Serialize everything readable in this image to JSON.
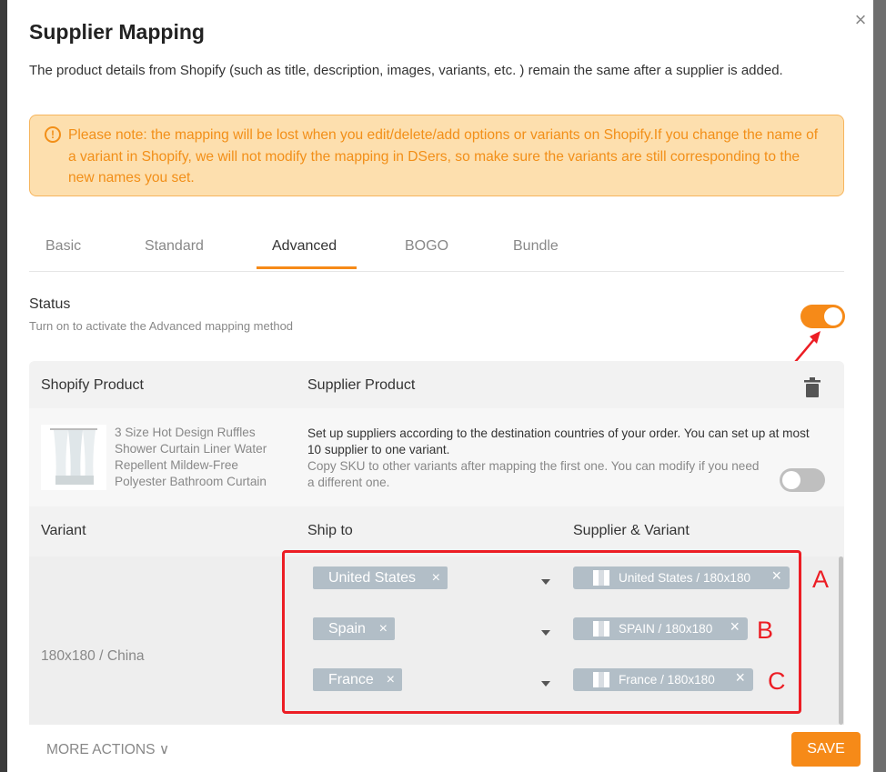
{
  "modal": {
    "title": "Supplier Mapping",
    "description": "The product details from Shopify (such as title, description, images, variants, etc. ) remain the same after a supplier is added.",
    "notice": "Please note: the mapping will be lost when you edit/delete/add options or variants on Shopify.If you change the name of a variant in Shopify, we will not modify the mapping in DSers, so make sure the variants are still corresponding to the new names you set.",
    "close_icon": "close-icon"
  },
  "tabs": [
    {
      "label": "Basic"
    },
    {
      "label": "Standard"
    },
    {
      "label": "Advanced",
      "active": true
    },
    {
      "label": "BOGO"
    },
    {
      "label": "Bundle"
    }
  ],
  "status": {
    "label": "Status",
    "sub": "Turn on to activate the Advanced mapping method",
    "enabled": true
  },
  "table": {
    "col_shopify": "Shopify Product",
    "col_supplier": "Supplier Product",
    "product_name": "3 Size Hot Design Ruffles Shower Curtain Liner Water Repellent Mildew-Free Polyester Bathroom Curtain",
    "setup_text": "Set up suppliers according to the destination countries of your order. You can set up at most 10 supplier to one variant.",
    "copy_sku_text": "Copy SKU to other variants after mapping the first one. You can modify if you need a different one.",
    "copy_sku_enabled": false,
    "col_variant": "Variant",
    "col_ship_to": "Ship to",
    "col_supplier_variant": "Supplier & Variant",
    "variant_name": "180x180 / China",
    "rows": [
      {
        "ship_to": "United States",
        "supplier_variant": "United States / 180x180",
        "letter": "A"
      },
      {
        "ship_to": "Spain",
        "supplier_variant": "SPAIN / 180x180",
        "letter": "B"
      },
      {
        "ship_to": "France",
        "supplier_variant": "France / 180x180",
        "letter": "C"
      }
    ]
  },
  "footer": {
    "more_actions": "MORE ACTIONS ∨",
    "save": "SAVE"
  },
  "colors": {
    "accent": "#f68a18",
    "notice_bg": "#fddfae",
    "annotation_red": "#ec1d24",
    "tag_bg": "#b2bec7"
  }
}
